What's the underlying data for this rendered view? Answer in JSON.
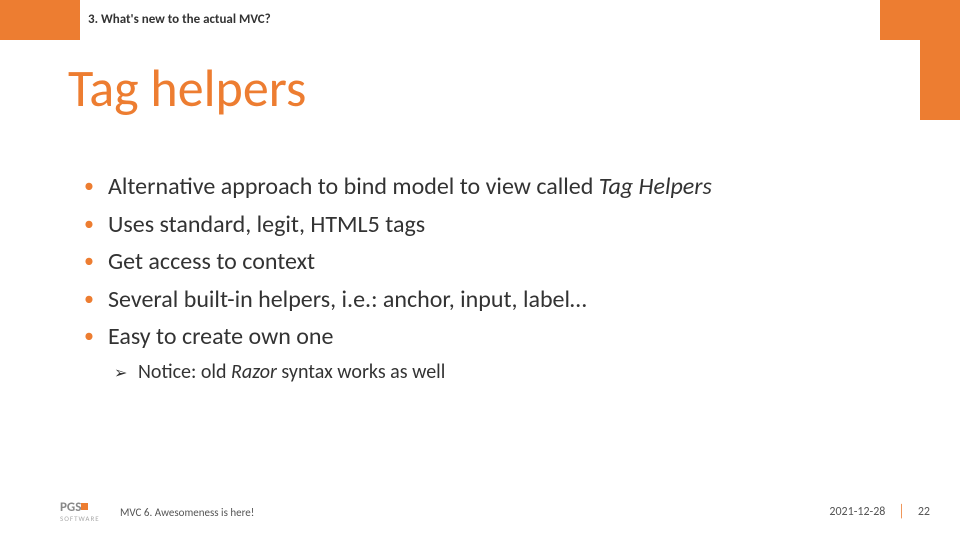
{
  "header": {
    "section": "3. What's new to the actual MVC?",
    "title": "Tag helpers"
  },
  "bullets": {
    "b0a": "Alternative approach to bind model to view called ",
    "b0b": "Tag Helpers",
    "b1": "Uses standard, legit, HTML5 tags",
    "b2": "Get access to context",
    "b3": "Several built-in helpers, i.e.: anchor, input, label…",
    "b4": "Easy to create own one",
    "sub_a": "Notice: old ",
    "sub_b": "Razor",
    "sub_c": " syntax works as well"
  },
  "footer": {
    "logo_main": "PGS",
    "logo_sub": "SOFTWARE",
    "tagline": "MVC 6. Awesomeness is here!",
    "date": "2021-12-28",
    "page": "22"
  }
}
